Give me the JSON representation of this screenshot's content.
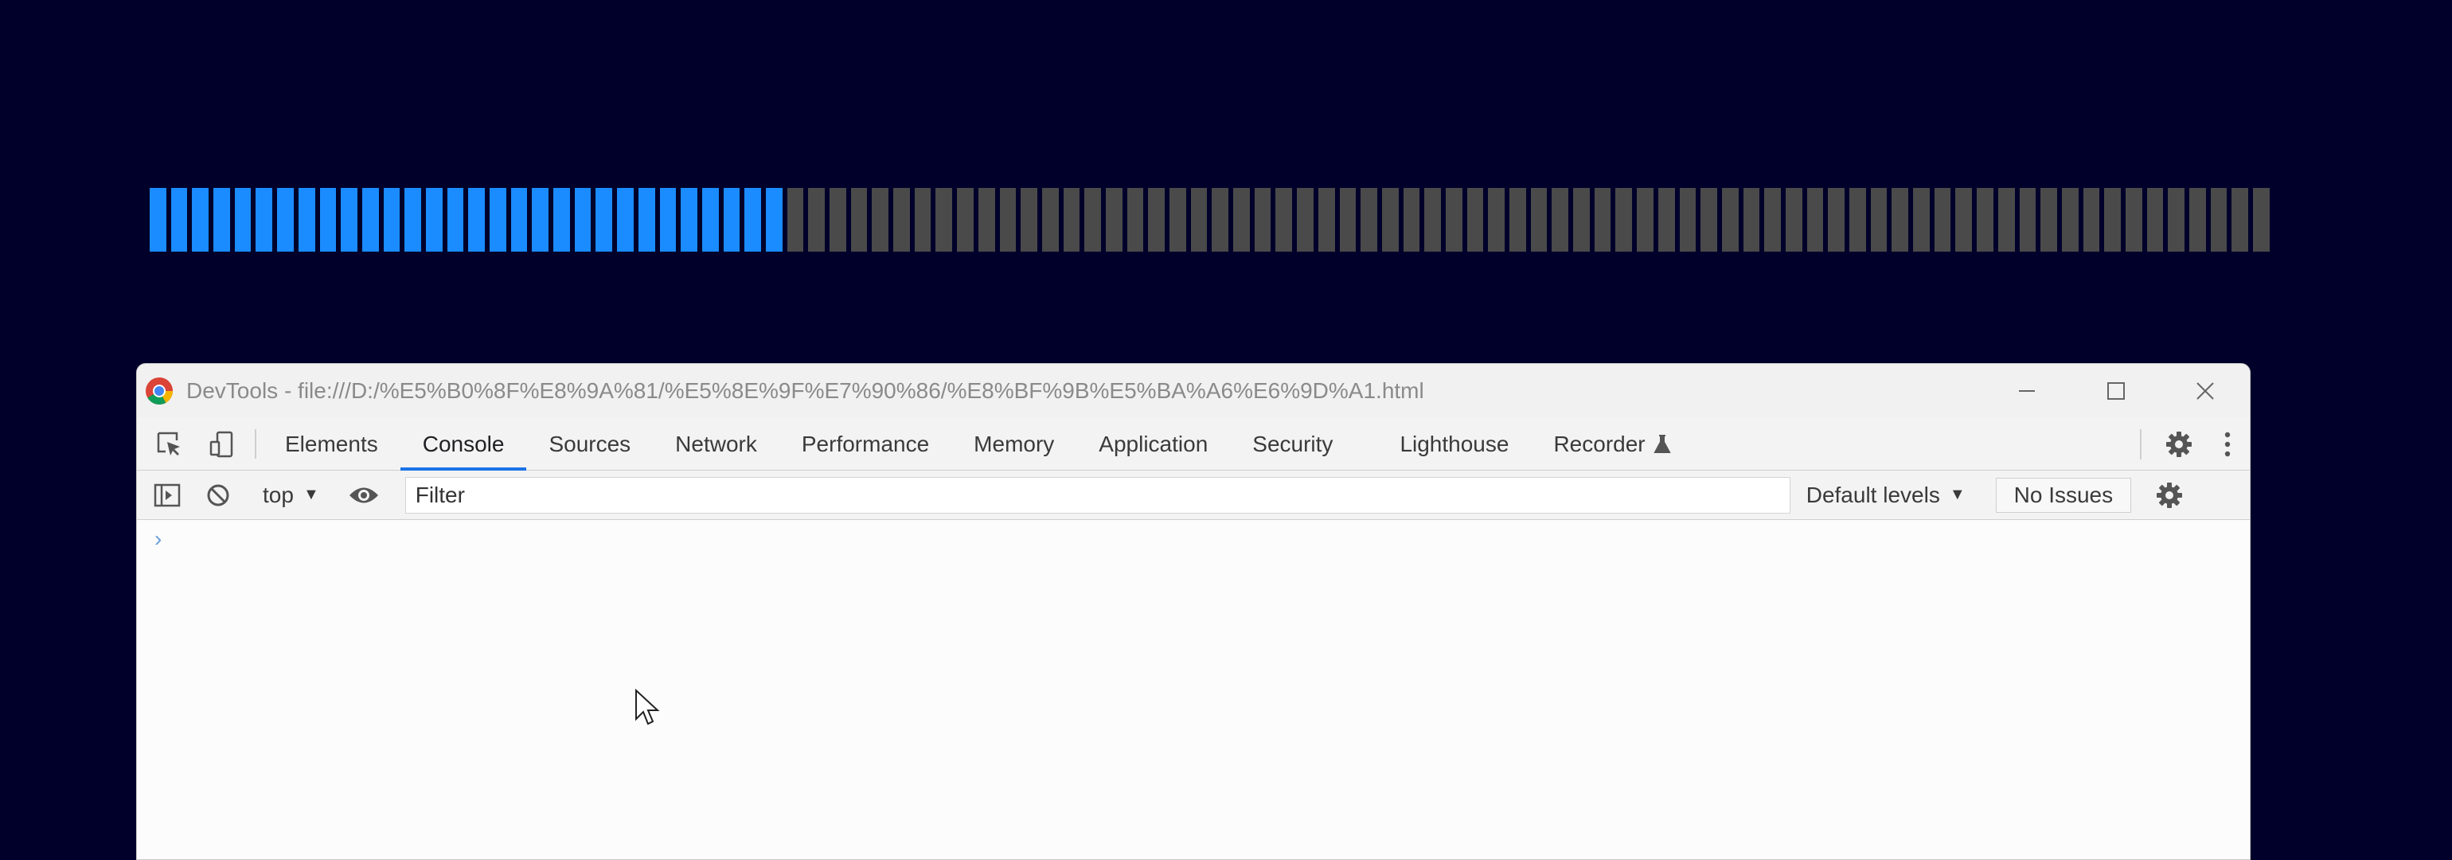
{
  "progress": {
    "total_segments": 100,
    "filled_segments": 30,
    "filled_color": "#1a8cff",
    "empty_color": "#4a4a4a"
  },
  "devtools": {
    "title": "DevTools - file:///D:/%E5%B0%8F%E8%9A%81/%E5%8E%9F%E7%90%86/%E8%BF%9B%E5%BA%A6%E6%9D%A1.html",
    "tabs": [
      {
        "label": "Elements",
        "active": false
      },
      {
        "label": "Console",
        "active": true
      },
      {
        "label": "Sources",
        "active": false
      },
      {
        "label": "Network",
        "active": false
      },
      {
        "label": "Performance",
        "active": false
      },
      {
        "label": "Memory",
        "active": false
      },
      {
        "label": "Application",
        "active": false
      },
      {
        "label": "Security",
        "active": false
      },
      {
        "label": "Lighthouse",
        "active": false
      },
      {
        "label": "Recorder",
        "active": false
      }
    ],
    "accent_color": "#1a73e8",
    "console": {
      "context": "top",
      "filter_placeholder": "Filter",
      "levels_label": "Default levels",
      "issues_label": "No Issues",
      "prompt": "›"
    }
  }
}
